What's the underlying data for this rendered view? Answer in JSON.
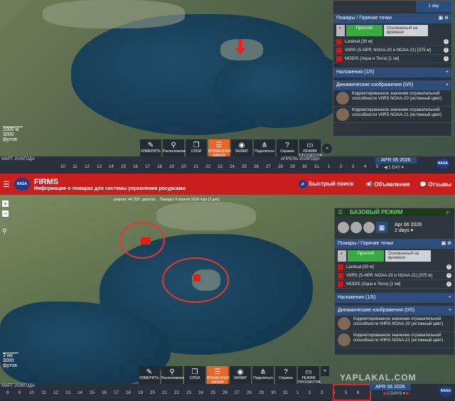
{
  "top": {
    "date_btn": "1 day",
    "fires_header": "Пожары / Горячие точки",
    "toggle_simple": "Простой",
    "toggle_time": "Основанный на времени",
    "sources": [
      "Landsat [30 м]",
      "VIIRS (S-NPP, NOAA-20 и NOAA-21) [375 м]",
      "MODIS (Aqua и Terra) [1 км]"
    ],
    "overlays_header": "Наложения (1/5)",
    "dynamic_header": "Динамические изображения (0/5)",
    "dynamic_items": [
      "Корректированное значение отражательной способности VIIRS NOAA-20 (истинный цвет)",
      "Корректированное значение отражательной способности VIIRS NOAA-21 (истинный цвет)"
    ],
    "tools": [
      "ИЗМЕРИТЬ",
      "Расположение",
      "СЛОИ",
      "ВРЕМЕННАЯ ШКАЛА",
      "ЗАХВАТ",
      "Поделиться",
      "Справка",
      "РЕЖИМ ПРОСМОТРА"
    ],
    "scale_top": "1000 м",
    "scale_bottom": "3000 футов",
    "month_label": "МАРТ 2026ГОДА",
    "month_label2": "АПРЕЛЬ 2026ГОДА",
    "date_pill": "APR 05 2026",
    "interval": "1 DAY",
    "ticks": [
      "10",
      "11",
      "12",
      "13",
      "14",
      "15",
      "16",
      "17",
      "18",
      "19",
      "20",
      "21",
      "22",
      "23",
      "24",
      "25",
      "26",
      "27",
      "28",
      "29",
      "30",
      "31",
      "1",
      "2",
      "3",
      "4",
      "5"
    ]
  },
  "header": {
    "logo": "NASA",
    "title": "FIRMS",
    "subtitle": "Информация о пожарах для системы управления ресурсами",
    "search": "Быстрый поиск",
    "announcements": "Объявления",
    "feedback": "Отзывы",
    "coords": "широта: 44.703°, долгота:",
    "fires_info": "Пожары: 6 апреля 2026 года (2 дня)"
  },
  "bottom": {
    "mode": "БАЗОВЫЙ РЕЖИМ",
    "date": "Apr 06 2026",
    "range": "2 days",
    "fires_header": "Пожары / Горячие точки",
    "toggle_simple": "Простой",
    "toggle_time": "Основанный на времени",
    "sources": [
      "Landsat [30 м]",
      "VIIRS (S-NPP, NOAA-20 и NOAA-21) [375 м]",
      "MODIS (Aqua и Terra) [1 км]"
    ],
    "overlays_header": "Наложения (1/5)",
    "dynamic_header": "Динамические изображения (0/5)",
    "dynamic_items": [
      "Корректированное значение отражательной способности VIIRS NOAA-20 (истинный цвет)",
      "Корректированное значение отражательной способности VIIRS NOAA-21 (истинный цвет)"
    ],
    "tools": [
      "ИЗМЕРИТЬ",
      "Расположение",
      "СЛОИ",
      "ВРЕМЕННАЯ ШКАЛА",
      "ЗАХВАТ",
      "Поделиться",
      "Справка",
      "РЕЖИМ ПРОСМОТРА"
    ],
    "scale_top": "3 км",
    "scale_bottom": "3000 футов",
    "month_label": "МАРТ 2026ГОДА",
    "date_pill": "APR 06 2026",
    "interval": "2 DAYS",
    "watermark": "YAPLAKAL.COM",
    "ticks": [
      "8",
      "9",
      "10",
      "11",
      "12",
      "13",
      "14",
      "15",
      "16",
      "17",
      "18",
      "19",
      "20",
      "21",
      "22",
      "23",
      "24",
      "25",
      "26",
      "27",
      "28",
      "29",
      "30",
      "31",
      "1",
      "2",
      "3",
      "4",
      "5",
      "6"
    ]
  },
  "colors": {
    "accent": "#e8662c",
    "header_red": "#c81e1e",
    "fire_red": "#e31b1b",
    "nasa_blue": "#1d3d8f",
    "toggle_green": "#3aa843"
  }
}
